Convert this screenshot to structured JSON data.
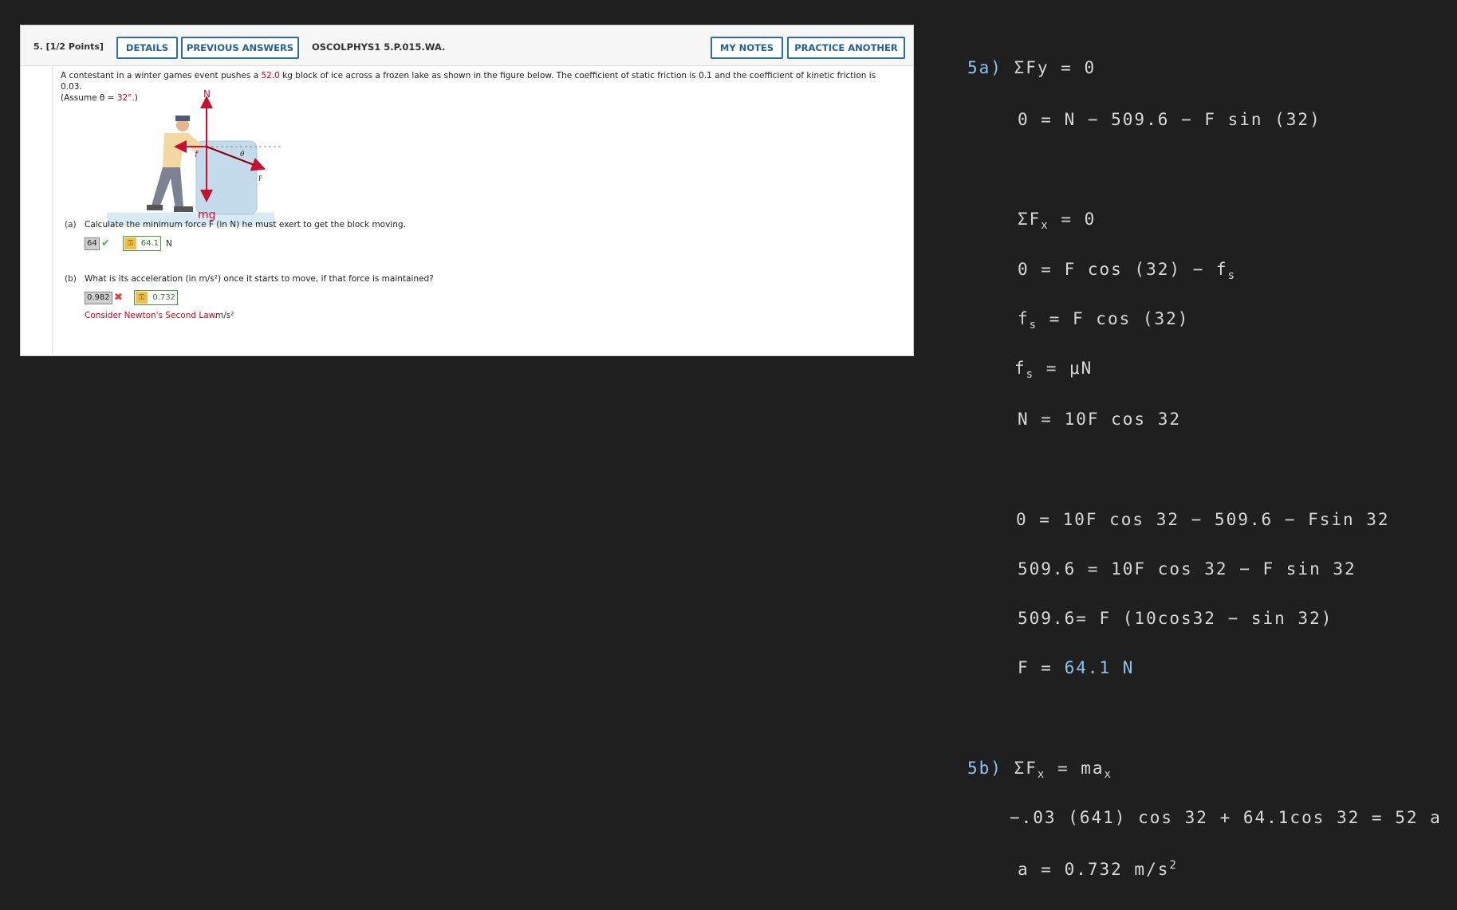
{
  "question": {
    "number_points": "5.  [1/2 Points]",
    "buttons": {
      "details": "DETAILS",
      "previous_answers": "PREVIOUS ANSWERS",
      "my_notes": "MY NOTES",
      "practice_another": "PRACTICE ANOTHER"
    },
    "code": "OSCOLPHYS1 5.P.015.WA.",
    "prompt": {
      "part1": "A contestant in a winter games event pushes a ",
      "mass": "52.0",
      "part2": " kg block of ice across a frozen lake as shown in the figure below. The coefficient of static friction is 0.1 and the coefficient of kinetic friction is 0.03.",
      "part3": "(Assume θ = ",
      "angle": "32°",
      "part4": ".)"
    },
    "figure": {
      "label_N": "N",
      "label_f": "f",
      "label_mg": "mg",
      "label_theta": "θ",
      "label_F": "F"
    },
    "part_a": {
      "label": "(a)",
      "text": "Calculate the minimum force F (in N) he must exert to get the block moving.",
      "submitted": "64",
      "status": "correct",
      "key_answer": "64.1",
      "unit": "N"
    },
    "part_b": {
      "label": "(b)",
      "text": "What is its acceleration (in m/s²) once it starts to move, if that force is maintained?",
      "submitted": "0.982",
      "status": "incorrect",
      "key_answer": "0.732",
      "hint": "Consider Newton's Second Law.",
      "unit": "m/s²"
    }
  },
  "colors": {
    "accent": "#22609a",
    "correct": "#4caf50",
    "incorrect": "#e53935",
    "highlight": "#d0021b",
    "handwriting": "#d8d8d8",
    "handwriting_answer": "#8ec3f0"
  },
  "notes": {
    "l1_label": "5a)",
    "l1_eq": "ΣFy = 0",
    "l2": "0 = N − 509.6 − F sin (32)",
    "l3_a": "ΣF",
    "l3_sub": "x",
    "l3_b": " = 0",
    "l4_a": "0 =  F cos (32) − f",
    "l4_sub": "s",
    "l5_a": "f",
    "l5_sub": "s",
    "l5_b": " =  F cos (32)",
    "l6_a": "f",
    "l6_sub": "s",
    "l6_b": " = μN",
    "l7": "N = 10F cos  32",
    "l8": "0 = 10F cos 32 − 509.6  − Fsin 32",
    "l9": "509.6 =  10F cos 32  −  F sin  32",
    "l10": "509.6=  F (10cos32 − sin 32)",
    "l11_a": "F = ",
    "l11_ans": "64.1 N",
    "l12_label": "5b)",
    "l12_a": "ΣF",
    "l12_sub": "x",
    "l12_b": " = ma",
    "l12_sub2": "x",
    "l13": "−.03 (641) cos 32  +  64.1cos 32   =  52 a",
    "l14_a": "a = 0.732 m/s",
    "l14_sup": "2"
  }
}
